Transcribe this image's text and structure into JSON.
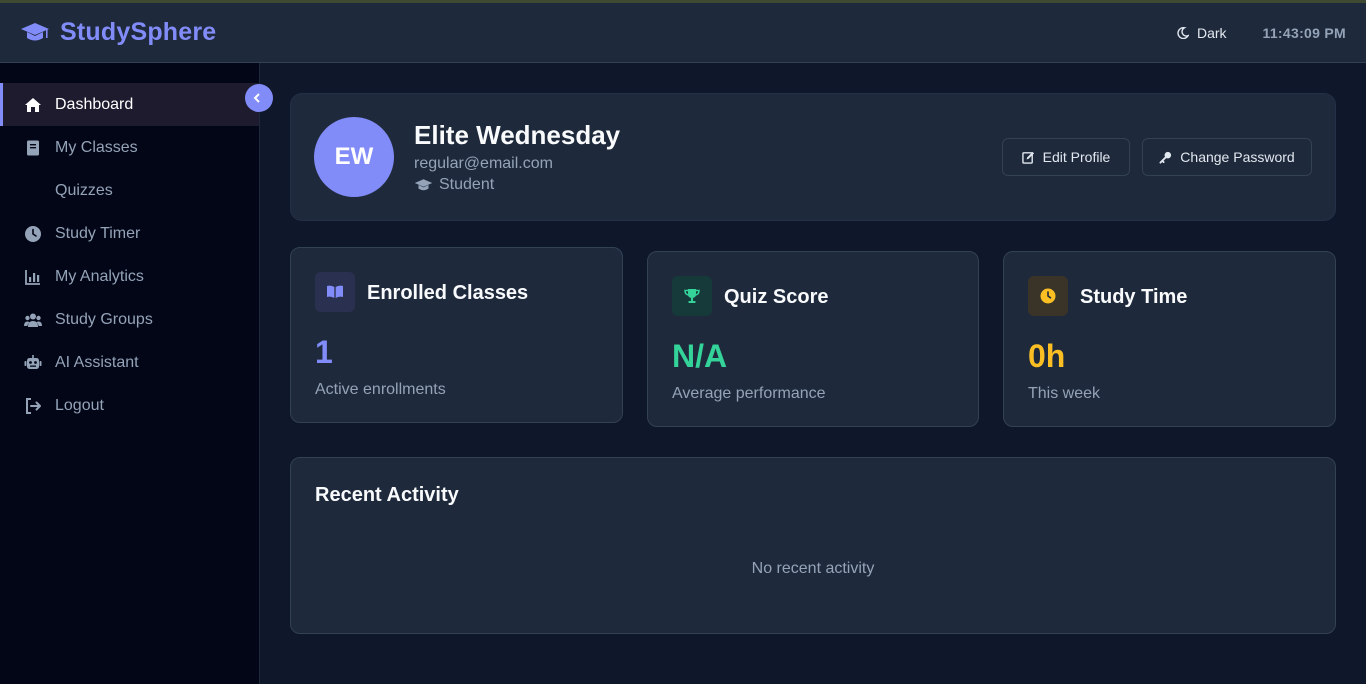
{
  "header": {
    "brand": "StudySphere",
    "theme_label": "Dark",
    "clock": "11:43:09 PM"
  },
  "sidebar": {
    "items": [
      {
        "label": "Dashboard",
        "icon": "home-icon",
        "active": true
      },
      {
        "label": "My Classes",
        "icon": "book-icon"
      },
      {
        "label": "Quizzes",
        "icon": "none"
      },
      {
        "label": "Study Timer",
        "icon": "clock-icon"
      },
      {
        "label": "My Analytics",
        "icon": "chart-icon"
      },
      {
        "label": "Study Groups",
        "icon": "users-icon"
      },
      {
        "label": "AI Assistant",
        "icon": "robot-icon"
      },
      {
        "label": "Logout",
        "icon": "logout-icon"
      }
    ]
  },
  "profile": {
    "initials": "EW",
    "name": "Elite Wednesday",
    "email": "regular@email.com",
    "role": "Student",
    "edit_label": "Edit Profile",
    "password_label": "Change Password"
  },
  "stats": [
    {
      "title": "Enrolled Classes",
      "value": "1",
      "sub": "Active enrollments",
      "icon": "open-book-icon",
      "color": "#818cf8"
    },
    {
      "title": "Quiz Score",
      "value": "N/A",
      "sub": "Average performance",
      "icon": "trophy-icon",
      "color": "#34d399"
    },
    {
      "title": "Study Time",
      "value": "0h",
      "sub": "This week",
      "icon": "clock-icon",
      "color": "#fbbf24"
    }
  ],
  "activity": {
    "title": "Recent Activity",
    "empty": "No recent activity"
  },
  "colors": {
    "accent": "#818cf8",
    "background": "#0f172a",
    "card": "#1e293b",
    "sidebar": "#020617"
  }
}
